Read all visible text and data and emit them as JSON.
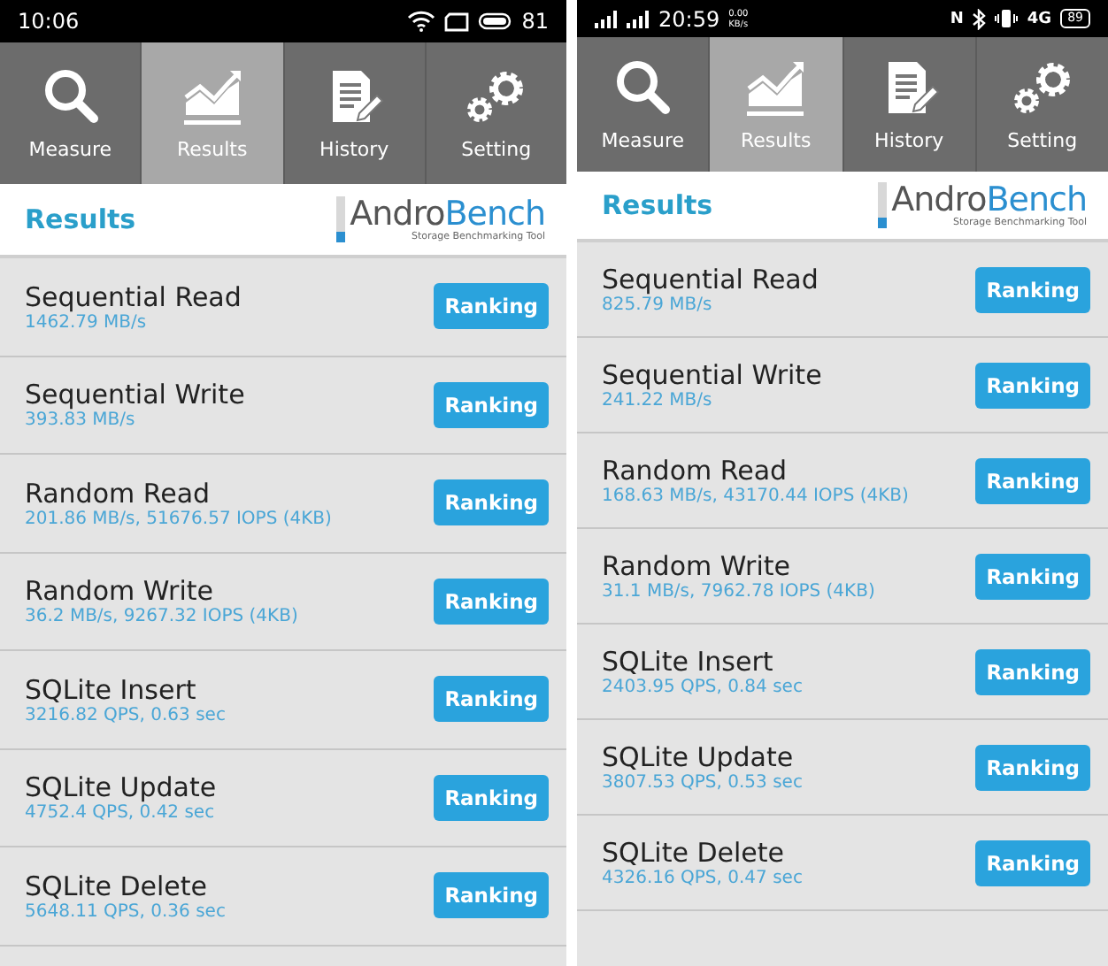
{
  "phones": [
    {
      "status_bar": {
        "left": [
          {
            "kind": "time",
            "text": "10:06"
          }
        ],
        "right": [
          {
            "kind": "wifi"
          },
          {
            "kind": "screen"
          },
          {
            "kind": "battery",
            "text": "81"
          }
        ]
      },
      "tabs": [
        {
          "label": "Measure",
          "selected": false
        },
        {
          "label": "Results",
          "selected": true
        },
        {
          "label": "History",
          "selected": false
        },
        {
          "label": "Setting",
          "selected": false
        }
      ],
      "header": {
        "title": "Results",
        "logo_part1": "Andro",
        "logo_part2": "Bench",
        "tagline": "Storage Benchmarking Tool"
      },
      "results": [
        {
          "name": "Sequential Read",
          "value": "1462.79 MB/s",
          "button": "Ranking"
        },
        {
          "name": "Sequential Write",
          "value": "393.83 MB/s",
          "button": "Ranking"
        },
        {
          "name": "Random Read",
          "value": "201.86 MB/s, 51676.57 IOPS (4KB)",
          "button": "Ranking"
        },
        {
          "name": "Random Write",
          "value": "36.2 MB/s, 9267.32 IOPS (4KB)",
          "button": "Ranking"
        },
        {
          "name": "SQLite Insert",
          "value": "3216.82 QPS, 0.63 sec",
          "button": "Ranking"
        },
        {
          "name": "SQLite Update",
          "value": "4752.4 QPS, 0.42 sec",
          "button": "Ranking"
        },
        {
          "name": "SQLite Delete",
          "value": "5648.11 QPS, 0.36 sec",
          "button": "Ranking"
        }
      ]
    },
    {
      "status_bar": {
        "left": [
          {
            "kind": "signal"
          },
          {
            "kind": "signal"
          },
          {
            "kind": "time",
            "text": "20:59"
          },
          {
            "kind": "speed",
            "text": "0.00",
            "unit": "KB/s"
          }
        ],
        "right": [
          {
            "kind": "label",
            "text": "N"
          },
          {
            "kind": "bluetooth"
          },
          {
            "kind": "vibrate"
          },
          {
            "kind": "label",
            "text": "4G"
          },
          {
            "kind": "battery-box",
            "text": "89"
          }
        ]
      },
      "tabs": [
        {
          "label": "Measure",
          "selected": false
        },
        {
          "label": "Results",
          "selected": true
        },
        {
          "label": "History",
          "selected": false
        },
        {
          "label": "Setting",
          "selected": false
        }
      ],
      "header": {
        "title": "Results",
        "logo_part1": "Andro",
        "logo_part2": "Bench",
        "tagline": "Storage Benchmarking Tool"
      },
      "results": [
        {
          "name": "Sequential Read",
          "value": "825.79 MB/s",
          "button": "Ranking"
        },
        {
          "name": "Sequential Write",
          "value": "241.22 MB/s",
          "button": "Ranking"
        },
        {
          "name": "Random Read",
          "value": "168.63 MB/s, 43170.44 IOPS (4KB)",
          "button": "Ranking"
        },
        {
          "name": "Random Write",
          "value": "31.1 MB/s, 7962.78 IOPS (4KB)",
          "button": "Ranking"
        },
        {
          "name": "SQLite Insert",
          "value": "2403.95 QPS, 0.84 sec",
          "button": "Ranking"
        },
        {
          "name": "SQLite Update",
          "value": "3807.53 QPS, 0.53 sec",
          "button": "Ranking"
        },
        {
          "name": "SQLite Delete",
          "value": "4326.16 QPS, 0.47 sec",
          "button": "Ranking"
        }
      ]
    }
  ]
}
